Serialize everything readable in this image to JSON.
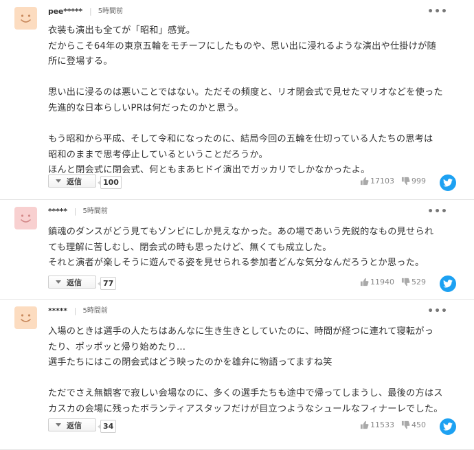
{
  "colors": {
    "avatar_orange": "#fcdcc0",
    "avatar_pink": "#f8d0d0",
    "twitter_blue": "#1da1f2"
  },
  "comments": [
    {
      "username": "pee*****",
      "time": "5時間前",
      "avatar": "smiley-orange",
      "text": "衣装も演出も全てが「昭和」感覚。\nだからこそ64年の東京五輪をモチーフにしたものや、思い出に浸れるような演出や仕掛けが随\n所に登場する。\n\n思い出に浸るのは悪いことではない。ただその頻度と、リオ閉会式で見せたマリオなどを使った\n先進的な日本らしいPRは何だったのかと思う。\n\nもう昭和から平成、そして令和になったのに、結局今回の五輪を仕切っている人たちの思考は\n昭和のままで思考停止しているということだろうか。\nほんと閉会式に閉会式、何ともまあヒドイ演出でガッカリでしかなかったよ。",
      "reply_label": "返信",
      "reply_count": "100",
      "likes": "17103",
      "dislikes": "999"
    },
    {
      "username": "*****",
      "time": "5時間前",
      "avatar": "smiley-pink",
      "text": "鎮魂のダンスがどう見てもゾンビにしか見えなかった。あの場であいう先鋭的なもの見せられ\nても理解に苦しむし、閉会式の時も思ったけど、無くても成立した。\nそれと演者が楽しそうに遊んでる姿を見せられる参加者どんな気分なんだろうとか思った。",
      "reply_label": "返信",
      "reply_count": "77",
      "likes": "11940",
      "dislikes": "529"
    },
    {
      "username": "*****",
      "time": "5時間前",
      "avatar": "smiley-orange",
      "text": "入場のときは選手の人たちはあんなに生き生きとしていたのに、時間が経つに連れて寝転がっ\nたり、ポッポッと帰り始めたり…\n選手たちにはこの閉会式はどう映ったのかを雄弁に物語ってますね笑\n\nただでさえ無観客で寂しい会場なのに、多くの選手たちも途中で帰ってしまうし、最後の方はス\nカスカの会場に残ったボランティアスタッフだけが目立つようなシュールなフィナーレでした。",
      "reply_label": "返信",
      "reply_count": "34",
      "likes": "11533",
      "dislikes": "450"
    }
  ]
}
